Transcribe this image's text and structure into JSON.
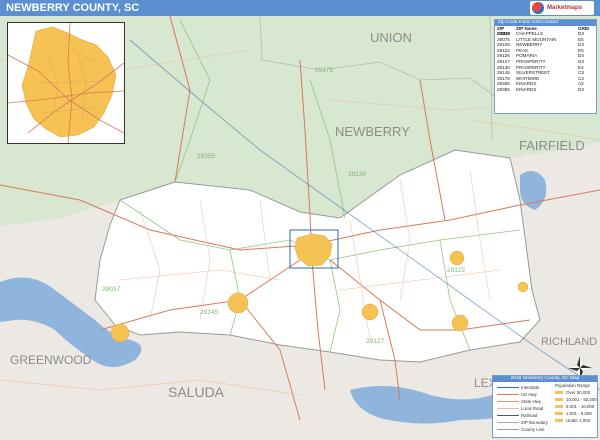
{
  "header": {
    "title": "NEWBERRY COUNTY, SC",
    "logo_text": "Marketmaps"
  },
  "county_labels": {
    "union": "UNION",
    "newberry": "NEWBERRY",
    "fairfield": "FAIRFIELD",
    "greenwood": "GREENWOOD",
    "saluda": "SALUDA",
    "richland": "RICHLAND",
    "lexington": "LEX"
  },
  "zip_labels": {
    "z29178": "29178",
    "z29355": "29355",
    "z29130": "29130",
    "z29122": "29122",
    "z29037": "29037",
    "z29145": "29145",
    "z29127": "29127"
  },
  "zip_table": {
    "title": "Zip Code Index Grid Locator",
    "columns": [
      "ZIP CODE",
      "ZIP Name",
      "GRID"
    ],
    "rows": [
      [
        "29037",
        "CHAPPELLS",
        "D3"
      ],
      [
        "29075",
        "LITTLE MOUNTAIN",
        "E5"
      ],
      [
        "29108",
        "NEWBERRY",
        "D3"
      ],
      [
        "29122",
        "PEAK",
        "E5"
      ],
      [
        "29126",
        "POMARIA",
        "D4"
      ],
      [
        "29127",
        "PROSPERITY",
        "D3"
      ],
      [
        "29130",
        "PROSPERITY",
        "E4"
      ],
      [
        "29145",
        "SILVERSTREET",
        "C3"
      ],
      [
        "29178",
        "WHITMIRE",
        "C2"
      ],
      [
        "29355",
        "KINARDS",
        "A2"
      ],
      [
        "29355",
        "KINARDS",
        "D3"
      ]
    ]
  },
  "legend": {
    "title": "2016 Newberry County, SC Map",
    "subtitle": "Population Range",
    "items": [
      "Interstate",
      "US Hwy",
      "State Hwy",
      "Local Road",
      "Railroad",
      "ZIP Boundary",
      "County Line"
    ],
    "ranges": [
      "Over 50,000",
      "10,001 - 50,000",
      "5,001 - 10,000",
      "1,001 - 5,000",
      "Under 1,000"
    ]
  },
  "colors": {
    "county_fill": "#ffffff",
    "surround_north": "#d8e7cf",
    "surround_south": "#ece8e3",
    "water": "#8fb5dc",
    "city": "#f6c253",
    "road_major": "#d9785b",
    "road_minor": "#f0b8a0",
    "zip_line": "#8fca7f",
    "interstate": "#2e6ab0",
    "header": "#5b8fd0"
  },
  "icons": {
    "compass": "compass-rose-icon",
    "logo": "logo-icon"
  }
}
